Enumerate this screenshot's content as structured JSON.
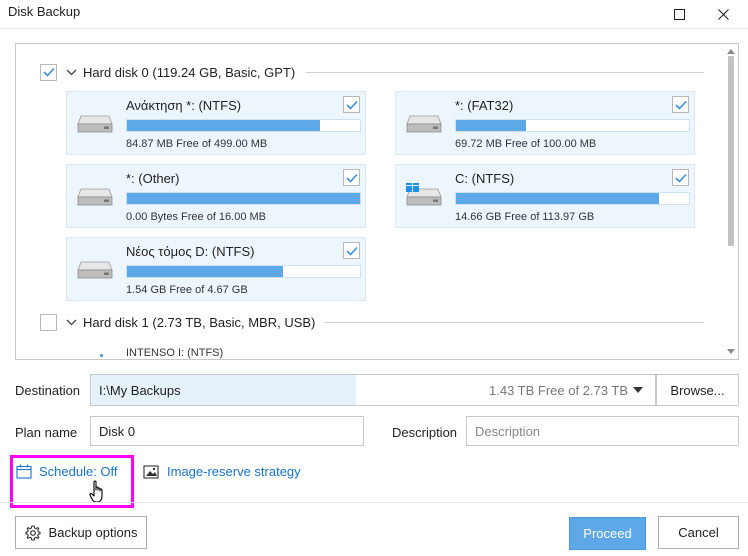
{
  "window": {
    "title": "Disk Backup",
    "maximize_icon": "maximize-icon",
    "close_icon": "close-icon"
  },
  "disks": [
    {
      "label": "Hard disk 0 (119.24 GB, Basic, GPT)",
      "checked": true,
      "partitions": [
        {
          "name": "Ανάκτηση *: (NTFS)",
          "free": "84.87 MB Free of 499.00 MB",
          "used_fraction": 0.83,
          "checked": true,
          "icon": "hdd-icon"
        },
        {
          "name": "*: (FAT32)",
          "free": "69.72 MB Free of 100.00 MB",
          "used_fraction": 0.3,
          "checked": true,
          "icon": "hdd-icon"
        },
        {
          "name": "*: (Other)",
          "free": "0.00 Bytes Free of 16.00 MB",
          "used_fraction": 1.0,
          "checked": true,
          "icon": "hdd-icon"
        },
        {
          "name": "C: (NTFS)",
          "free": "14.66 GB Free of 113.97 GB",
          "used_fraction": 0.87,
          "checked": true,
          "icon": "windows-drive-icon"
        },
        {
          "name": "Νέος τόμος D: (NTFS)",
          "free": "1.54 GB Free of 4.67 GB",
          "used_fraction": 0.67,
          "checked": true,
          "icon": "hdd-icon"
        }
      ]
    },
    {
      "label": "Hard disk 1 (2.73 TB, Basic, MBR, USB)",
      "checked": false,
      "partitions": [
        {
          "name": "INTENSO I: (NTFS)",
          "partial": true
        }
      ]
    }
  ],
  "destination": {
    "label": "Destination",
    "value": "I:\\My Backups",
    "free": "1.43 TB Free of 2.73 TB",
    "browse_label": "Browse..."
  },
  "plan": {
    "label": "Plan name",
    "value": "Disk 0"
  },
  "description": {
    "label": "Description",
    "placeholder": "Description",
    "value": ""
  },
  "links": {
    "schedule": "Schedule: Off",
    "image_reserve": "Image-reserve strategy"
  },
  "buttons": {
    "backup_options": "Backup options",
    "proceed": "Proceed",
    "cancel": "Cancel"
  },
  "colors": {
    "accent": "#5fa8e8",
    "link": "#1a73c9",
    "highlight": "#ff00ff",
    "partition_bg": "#eef6fd"
  }
}
